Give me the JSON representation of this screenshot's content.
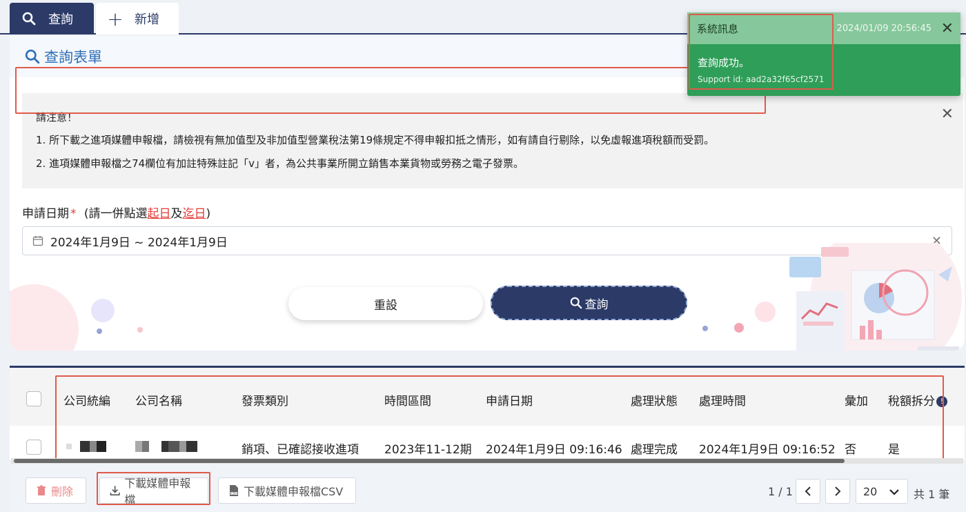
{
  "tabs": {
    "query_label": "查詢",
    "add_label": "新增"
  },
  "form": {
    "title": "查詢表單",
    "notice": {
      "heading": "請注意！",
      "line1": "1. 所下載之進項媒體申報檔，請檢視有無加值型及非加值型營業稅法第19條規定不得申報扣抵之情形，如有請自行剔除，以免虛報進項稅額而受罰。",
      "line2": "2. 進項媒體申報檔之74欄位有加註特殊註記「v」者，為公共事業所開立銷售本業貨物或勞務之電子發票。"
    },
    "date_label": "申請日期",
    "required_mark": "*",
    "hint_prefix": "(請一併點選",
    "hint_start": "起日",
    "hint_mid": "及",
    "hint_end": "迄日",
    "hint_suffix": ")",
    "date_value": "2024年1月9日 ~ 2024年1月9日",
    "reset_label": "重設",
    "search_label": "查詢"
  },
  "toast": {
    "title": "系統訊息",
    "time": "2024/01/09 20:56:45",
    "message": "查詢成功。",
    "support": "Support id: aad2a32f65cf2571"
  },
  "table": {
    "headers": [
      "公司統編",
      "公司名稱",
      "發票類別",
      "時間區間",
      "申請日期",
      "處理狀態",
      "處理時間",
      "彙加",
      "稅額拆分"
    ],
    "row": {
      "invoice_type": "銷項、已確認接收進項",
      "period": "2023年11-12期",
      "apply_date": "2024年1月9日 09:16:46",
      "status": "處理完成",
      "process_time": "2024年1月9日 09:16:52",
      "aggregate": "否",
      "tax_split": "是"
    }
  },
  "footer": {
    "delete_label": "刪除",
    "download_label": "下載媒體申報檔",
    "download_csv_label": "下載媒體申報檔CSV",
    "page_info": "1 / 1",
    "page_size": "20",
    "total": "共 1 筆"
  },
  "colors": {
    "navy": "#2b3a67",
    "toast_green": "#2f9e58",
    "highlight": "#e05a4a",
    "link_blue": "#2e6fb7"
  }
}
